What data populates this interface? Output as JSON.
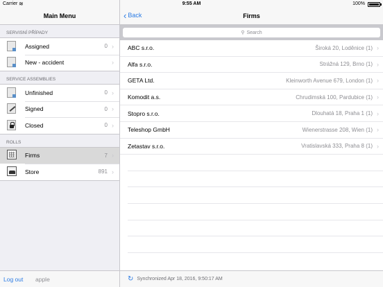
{
  "status_bar": {
    "carrier": "Carrier",
    "time": "9:55 AM",
    "battery": "100%"
  },
  "master": {
    "title": "Main Menu",
    "sections": [
      {
        "header": "SERVISNÍ PŘÍPADY",
        "items": [
          {
            "label": "Assigned",
            "count": "0",
            "icon": "document-icon"
          },
          {
            "label": "New - accident",
            "count": "",
            "icon": "document-icon"
          }
        ]
      },
      {
        "header": "SERVICE ASSEMBLIES",
        "items": [
          {
            "label": "Unfinished",
            "count": "0",
            "icon": "document-icon"
          },
          {
            "label": "Signed",
            "count": "0",
            "icon": "pen-icon"
          },
          {
            "label": "Closed",
            "count": "0",
            "icon": "lock-icon"
          }
        ]
      },
      {
        "header": "ROLLS",
        "items": [
          {
            "label": "Firms",
            "count": "7",
            "icon": "building-icon",
            "selected": true
          },
          {
            "label": "Store",
            "count": "891",
            "icon": "store-icon"
          }
        ]
      }
    ],
    "footer": {
      "logout": "Log out",
      "user": "apple"
    }
  },
  "detail": {
    "back_label": "Back",
    "title": "Firms",
    "search_placeholder": "Search",
    "firms": [
      {
        "name": "ABC s.r.o.",
        "address": "Široká 20, Loděnice (1)"
      },
      {
        "name": "Alfa s.r.o.",
        "address": "Strážná 129, Brno (1)"
      },
      {
        "name": "GETA Ltd.",
        "address": "Kleinworth Avenue 679, London (1)"
      },
      {
        "name": "Komodit a.s.",
        "address": "Chrudimská 100, Pardubice (1)"
      },
      {
        "name": "Stopro s.r.o.",
        "address": "Dlouhatá 18, Praha 1 (1)"
      },
      {
        "name": "Teleshop GmbH",
        "address": "Wienerstrasse 208, Wien (1)"
      },
      {
        "name": "Zetastav s.r.o.",
        "address": "Vratislavská 333, Praha 8 (1)"
      }
    ],
    "sync_text": "Synchronized Apr 18, 2016, 9:50:17 AM"
  }
}
